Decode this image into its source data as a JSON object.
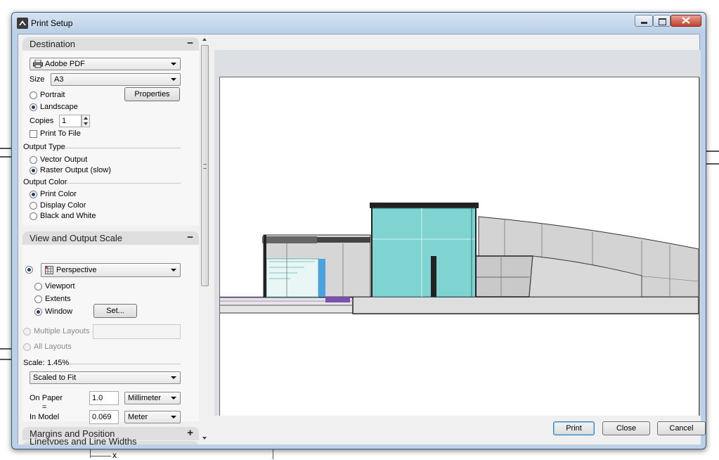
{
  "window": {
    "title": "Print Setup"
  },
  "destination": {
    "header": "Destination",
    "toggle": "−",
    "printer": "Adobe PDF",
    "size_label": "Size",
    "size_value": "A3",
    "portrait": "Portrait",
    "landscape": "Landscape",
    "orientation_selected": "Landscape",
    "properties_button": "Properties",
    "copies_label": "Copies",
    "copies_value": "1",
    "print_to_file": "Print To File",
    "print_to_file_checked": false,
    "output_type_label": "Output Type",
    "vector_output": "Vector Output",
    "raster_output": "Raster Output (slow)",
    "output_type_selected": "Raster Output (slow)",
    "output_color_label": "Output Color",
    "print_color": "Print Color",
    "display_color": "Display Color",
    "black_white": "Black and White",
    "output_color_selected": "Print Color"
  },
  "view_scale": {
    "header": "View and Output Scale",
    "toggle": "−",
    "view_value": "Perspective",
    "viewport": "Viewport",
    "extents": "Extents",
    "window": "Window",
    "area_selected": "Window",
    "set_button": "Set...",
    "multiple_layouts": "Multiple Layouts",
    "all_layouts": "All Layouts",
    "scale_label": "Scale:",
    "scale_value": "1.45%",
    "scale_mode": "Scaled to Fit",
    "on_paper_label": "On Paper",
    "equals": "=",
    "on_paper_value": "1.0",
    "on_paper_unit": "Millimeter",
    "in_model_label": "In Model",
    "in_model_value": "0.069",
    "in_model_unit": "Meter"
  },
  "margins": {
    "header": "Margins and Position",
    "toggle": "+"
  },
  "next_section": {
    "header": "Linetypes and Line Widths"
  },
  "buttons": {
    "print": "Print",
    "close": "Close",
    "cancel": "Cancel"
  },
  "colors": {
    "accent_glass": "#7fd3d0",
    "accent_blue": "#4aa3e0",
    "titlebar": "#c6d8ec",
    "panel_header": "#dedede"
  },
  "icons": [
    "app-icon",
    "printer-icon",
    "viewport-grid-icon",
    "dropdown-arrow-icon",
    "scroll-up-icon",
    "scroll-down-icon",
    "grip-icon"
  ]
}
